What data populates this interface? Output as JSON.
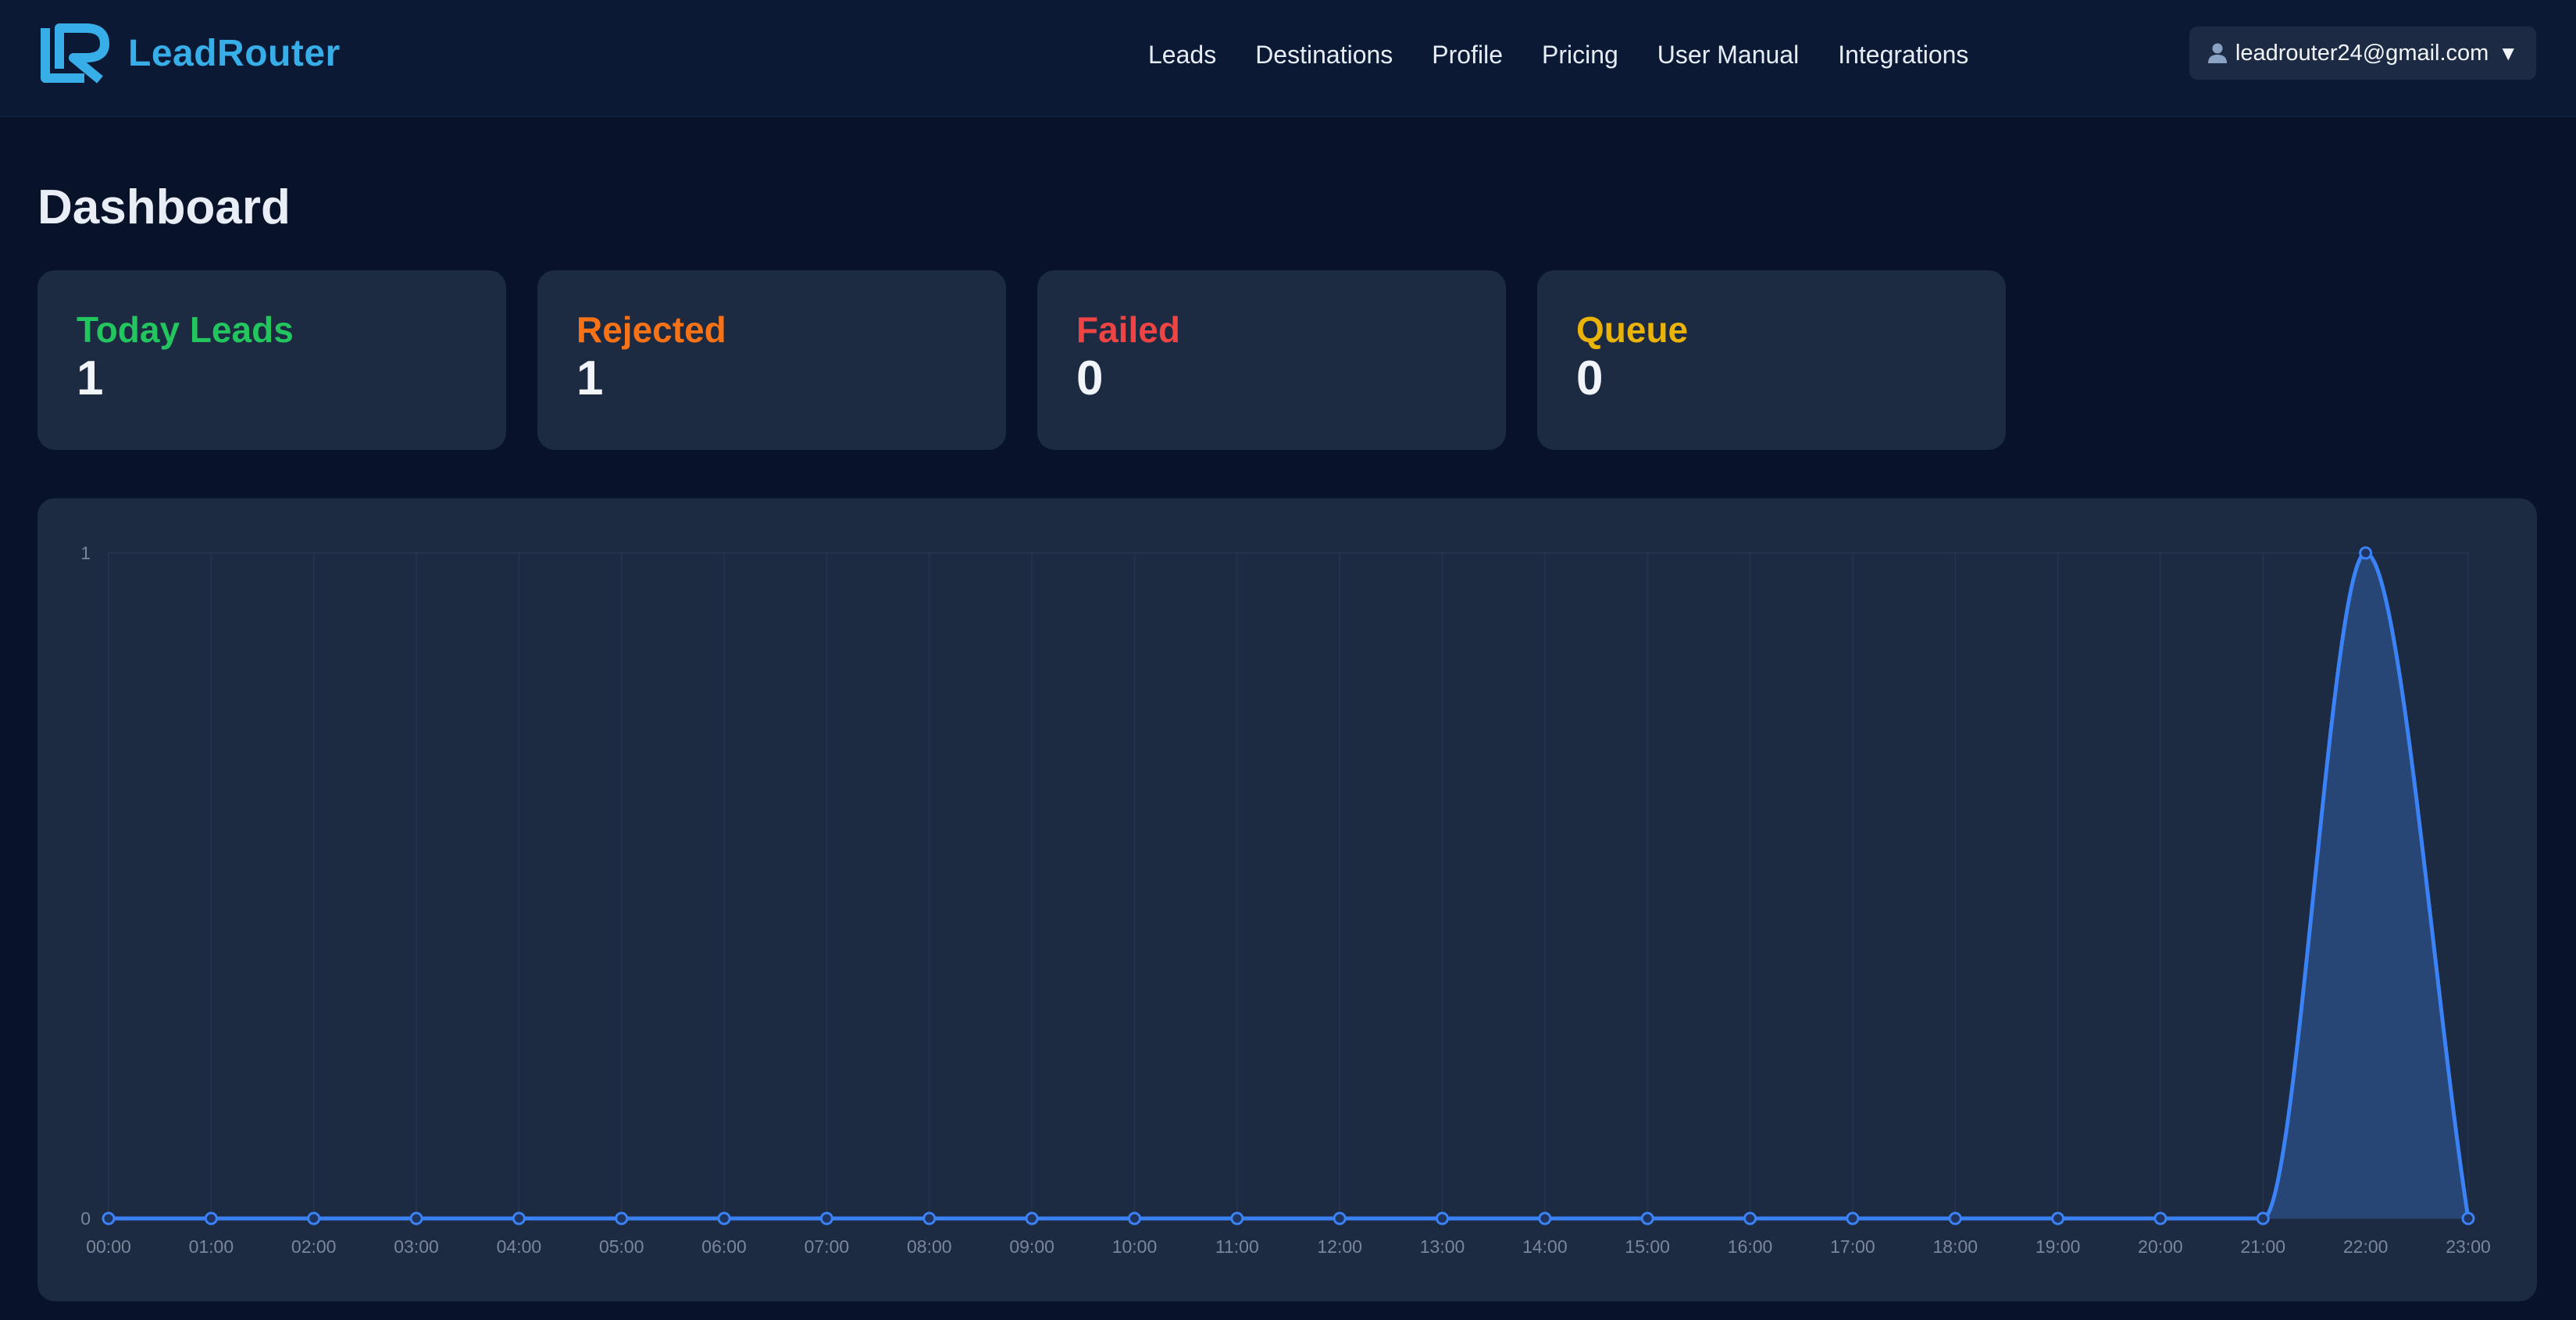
{
  "app": {
    "name": "LeadRouter"
  },
  "nav": {
    "items": [
      {
        "label": "Leads"
      },
      {
        "label": "Destinations"
      },
      {
        "label": "Profile"
      },
      {
        "label": "Pricing"
      },
      {
        "label": "User Manual"
      },
      {
        "label": "Integrations"
      }
    ]
  },
  "user_menu": {
    "email": "leadrouter24@gmail.com",
    "caret": "▼",
    "icon": "user-icon"
  },
  "page": {
    "title": "Dashboard"
  },
  "stats": [
    {
      "label": "Today Leads",
      "value": "1",
      "color": "#22c55e"
    },
    {
      "label": "Rejected",
      "value": "1",
      "color": "#f97316"
    },
    {
      "label": "Failed",
      "value": "0",
      "color": "#ef4444"
    },
    {
      "label": "Queue",
      "value": "0",
      "color": "#eab308"
    }
  ],
  "colors": {
    "line": "#3b82f6",
    "area": "#274575",
    "grid": "#273450",
    "panel": "#1c2a42",
    "background": "#08132a"
  },
  "chart_data": {
    "type": "area",
    "x": [
      "00:00",
      "01:00",
      "02:00",
      "03:00",
      "04:00",
      "05:00",
      "06:00",
      "07:00",
      "08:00",
      "09:00",
      "10:00",
      "11:00",
      "12:00",
      "13:00",
      "14:00",
      "15:00",
      "16:00",
      "17:00",
      "18:00",
      "19:00",
      "20:00",
      "21:00",
      "22:00",
      "23:00"
    ],
    "series": [
      {
        "values": [
          0,
          0,
          0,
          0,
          0,
          0,
          0,
          0,
          0,
          0,
          0,
          0,
          0,
          0,
          0,
          0,
          0,
          0,
          0,
          0,
          0,
          0,
          1,
          0
        ]
      }
    ],
    "ylim": [
      0,
      1
    ],
    "yticks": [
      "0",
      "1"
    ],
    "grid": true,
    "legend": "none"
  }
}
